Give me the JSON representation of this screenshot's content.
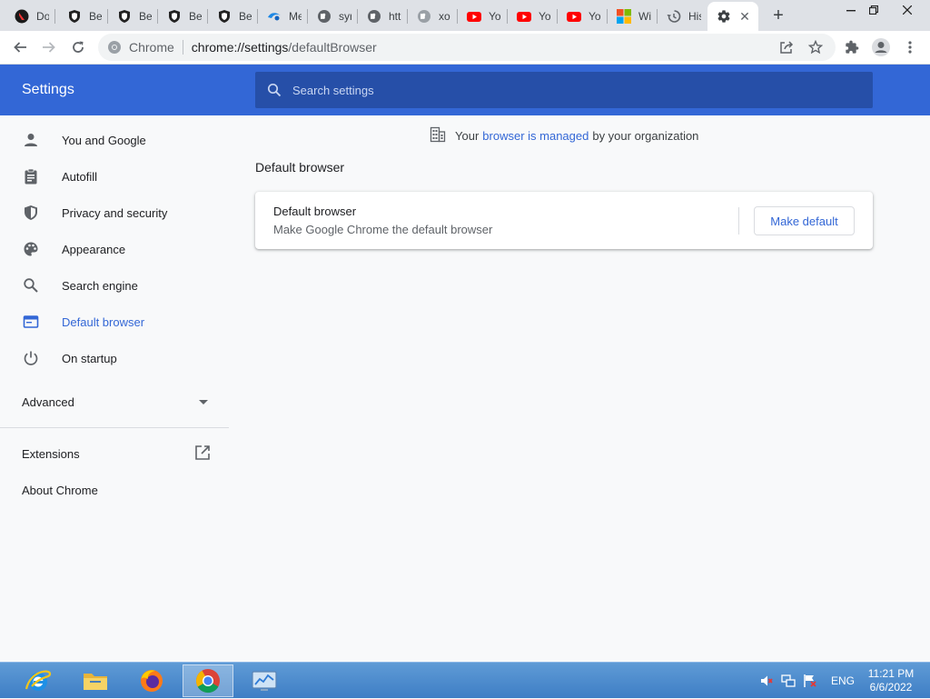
{
  "tabs": [
    {
      "title": "Do",
      "icon": "red-logo-icon"
    },
    {
      "title": "Be",
      "icon": "shield-icon"
    },
    {
      "title": "Be",
      "icon": "shield-icon"
    },
    {
      "title": "Be",
      "icon": "shield-icon"
    },
    {
      "title": "Be",
      "icon": "shield-icon"
    },
    {
      "title": "Me",
      "icon": "blue-swirl-icon"
    },
    {
      "title": "syr",
      "icon": "globe-icon"
    },
    {
      "title": "htt",
      "icon": "globe-icon"
    },
    {
      "title": "xo",
      "icon": "globe-icon"
    },
    {
      "title": "Yo",
      "icon": "youtube-icon"
    },
    {
      "title": "Yo",
      "icon": "youtube-icon"
    },
    {
      "title": "Yo",
      "icon": "youtube-icon"
    },
    {
      "title": "Wi",
      "icon": "windows-icon"
    },
    {
      "title": "His",
      "icon": "history-icon"
    },
    {
      "title": "",
      "icon": "gear-icon",
      "active": true
    }
  ],
  "toolbar": {
    "site_label": "Chrome",
    "url_host": "chrome://settings",
    "url_path": "/defaultBrowser"
  },
  "header": {
    "title": "Settings",
    "search_placeholder": "Search settings"
  },
  "sidebar": {
    "items": [
      {
        "label": "You and Google",
        "icon": "person-icon"
      },
      {
        "label": "Autofill",
        "icon": "clipboard-icon"
      },
      {
        "label": "Privacy and security",
        "icon": "shield-icon"
      },
      {
        "label": "Appearance",
        "icon": "palette-icon"
      },
      {
        "label": "Search engine",
        "icon": "search-icon"
      },
      {
        "label": "Default browser",
        "icon": "browser-icon",
        "selected": true
      },
      {
        "label": "On startup",
        "icon": "power-icon"
      }
    ],
    "advanced_label": "Advanced",
    "extensions_label": "Extensions",
    "about_label": "About Chrome"
  },
  "main": {
    "managed_prefix": "Your",
    "managed_link": "browser is managed",
    "managed_suffix": "by your organization",
    "section_title": "Default browser",
    "card": {
      "primary": "Default browser",
      "secondary": "Make Google Chrome the default browser",
      "button_label": "Make default"
    }
  },
  "taskbar": {
    "apps": [
      {
        "name": "internet-explorer-icon"
      },
      {
        "name": "file-explorer-icon"
      },
      {
        "name": "firefox-icon"
      },
      {
        "name": "chrome-icon",
        "active": true
      },
      {
        "name": "control-panel-icon"
      }
    ],
    "language": "ENG",
    "time": "11:21 PM",
    "date": "6/6/2022"
  },
  "colors": {
    "accent": "#3367d6",
    "header_bg": "#3367d6",
    "search_bg": "#264fa8",
    "page_bg": "#f8f9fa",
    "taskbar": "#3e7ec5"
  }
}
